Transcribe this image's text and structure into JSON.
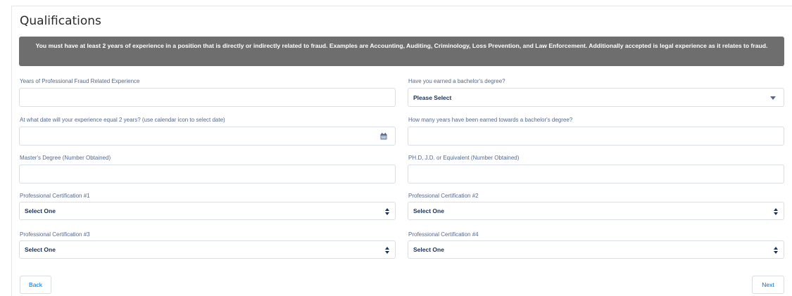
{
  "page": {
    "title": "Qualifications",
    "notice": "You must have at least 2 years of experience in a position that is directly or indirectly related to fraud. Examples are Accounting, Auditing, Criminology, Loss Prevention, and Law Enforcement. Additionally accepted is legal experience as it relates to fraud."
  },
  "fields": {
    "years_experience": {
      "label": "Years of Professional Fraud Related Experience",
      "value": ""
    },
    "bachelors": {
      "label": "Have you earned a bachelor's degree?",
      "value": "Please Select"
    },
    "experience_date": {
      "label": "At what date will your experience equal 2 years? (use calendar icon to select date)",
      "value": ""
    },
    "years_towards_bachelors": {
      "label": "How many years have been earned towards a bachelor's degree?",
      "value": ""
    },
    "masters": {
      "label": "Master's Degree (Number Obtained)",
      "value": ""
    },
    "phd": {
      "label": "PH.D, J.D. or Equivalent (Number Obtained)",
      "value": ""
    },
    "cert1": {
      "label": "Professional Certification #1",
      "value": "Select One"
    },
    "cert2": {
      "label": "Professional Certification #2",
      "value": "Select One"
    },
    "cert3": {
      "label": "Professional Certification #3",
      "value": "Select One"
    },
    "cert4": {
      "label": "Professional Certification #4",
      "value": "Select One"
    }
  },
  "buttons": {
    "back": "Back",
    "next": "Next"
  },
  "icons": {
    "calendar": "calendar-icon",
    "select_arrow": "chevron-down-icon",
    "spinner": "up-down-arrows-icon"
  },
  "colors": {
    "banner": "#6e6e6e",
    "link": "#0070d2",
    "label": "#54698d"
  }
}
